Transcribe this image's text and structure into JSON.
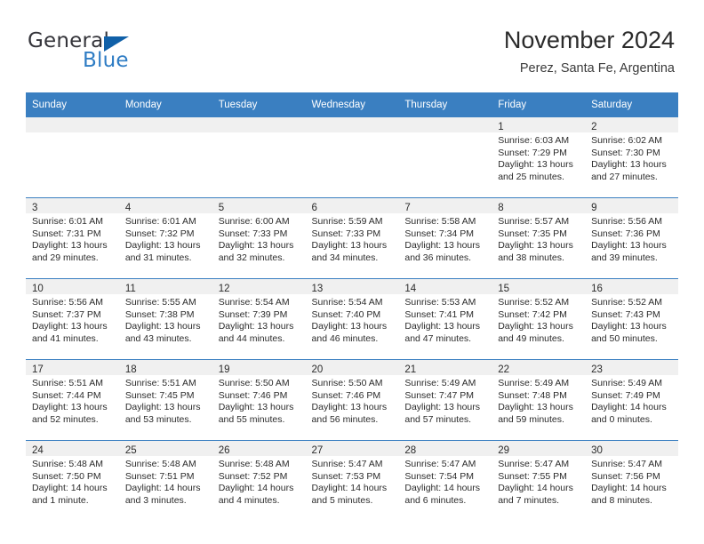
{
  "brand": {
    "name_part1": "General",
    "name_part2": "Blue",
    "triangle_color": "#1060a8",
    "blue_color": "#2e7cc4"
  },
  "header": {
    "title": "November 2024",
    "subtitle": "Perez, Santa Fe, Argentina",
    "header_bg": "#3a7fc1",
    "daynum_band_bg": "#f0f0f0"
  },
  "weekdays": [
    "Sunday",
    "Monday",
    "Tuesday",
    "Wednesday",
    "Thursday",
    "Friday",
    "Saturday"
  ],
  "weeks": [
    [
      {
        "day": "",
        "sunrise": "",
        "sunset": "",
        "daylight1": "",
        "daylight2": ""
      },
      {
        "day": "",
        "sunrise": "",
        "sunset": "",
        "daylight1": "",
        "daylight2": ""
      },
      {
        "day": "",
        "sunrise": "",
        "sunset": "",
        "daylight1": "",
        "daylight2": ""
      },
      {
        "day": "",
        "sunrise": "",
        "sunset": "",
        "daylight1": "",
        "daylight2": ""
      },
      {
        "day": "",
        "sunrise": "",
        "sunset": "",
        "daylight1": "",
        "daylight2": ""
      },
      {
        "day": "1",
        "sunrise": "Sunrise: 6:03 AM",
        "sunset": "Sunset: 7:29 PM",
        "daylight1": "Daylight: 13 hours",
        "daylight2": "and 25 minutes."
      },
      {
        "day": "2",
        "sunrise": "Sunrise: 6:02 AM",
        "sunset": "Sunset: 7:30 PM",
        "daylight1": "Daylight: 13 hours",
        "daylight2": "and 27 minutes."
      }
    ],
    [
      {
        "day": "3",
        "sunrise": "Sunrise: 6:01 AM",
        "sunset": "Sunset: 7:31 PM",
        "daylight1": "Daylight: 13 hours",
        "daylight2": "and 29 minutes."
      },
      {
        "day": "4",
        "sunrise": "Sunrise: 6:01 AM",
        "sunset": "Sunset: 7:32 PM",
        "daylight1": "Daylight: 13 hours",
        "daylight2": "and 31 minutes."
      },
      {
        "day": "5",
        "sunrise": "Sunrise: 6:00 AM",
        "sunset": "Sunset: 7:33 PM",
        "daylight1": "Daylight: 13 hours",
        "daylight2": "and 32 minutes."
      },
      {
        "day": "6",
        "sunrise": "Sunrise: 5:59 AM",
        "sunset": "Sunset: 7:33 PM",
        "daylight1": "Daylight: 13 hours",
        "daylight2": "and 34 minutes."
      },
      {
        "day": "7",
        "sunrise": "Sunrise: 5:58 AM",
        "sunset": "Sunset: 7:34 PM",
        "daylight1": "Daylight: 13 hours",
        "daylight2": "and 36 minutes."
      },
      {
        "day": "8",
        "sunrise": "Sunrise: 5:57 AM",
        "sunset": "Sunset: 7:35 PM",
        "daylight1": "Daylight: 13 hours",
        "daylight2": "and 38 minutes."
      },
      {
        "day": "9",
        "sunrise": "Sunrise: 5:56 AM",
        "sunset": "Sunset: 7:36 PM",
        "daylight1": "Daylight: 13 hours",
        "daylight2": "and 39 minutes."
      }
    ],
    [
      {
        "day": "10",
        "sunrise": "Sunrise: 5:56 AM",
        "sunset": "Sunset: 7:37 PM",
        "daylight1": "Daylight: 13 hours",
        "daylight2": "and 41 minutes."
      },
      {
        "day": "11",
        "sunrise": "Sunrise: 5:55 AM",
        "sunset": "Sunset: 7:38 PM",
        "daylight1": "Daylight: 13 hours",
        "daylight2": "and 43 minutes."
      },
      {
        "day": "12",
        "sunrise": "Sunrise: 5:54 AM",
        "sunset": "Sunset: 7:39 PM",
        "daylight1": "Daylight: 13 hours",
        "daylight2": "and 44 minutes."
      },
      {
        "day": "13",
        "sunrise": "Sunrise: 5:54 AM",
        "sunset": "Sunset: 7:40 PM",
        "daylight1": "Daylight: 13 hours",
        "daylight2": "and 46 minutes."
      },
      {
        "day": "14",
        "sunrise": "Sunrise: 5:53 AM",
        "sunset": "Sunset: 7:41 PM",
        "daylight1": "Daylight: 13 hours",
        "daylight2": "and 47 minutes."
      },
      {
        "day": "15",
        "sunrise": "Sunrise: 5:52 AM",
        "sunset": "Sunset: 7:42 PM",
        "daylight1": "Daylight: 13 hours",
        "daylight2": "and 49 minutes."
      },
      {
        "day": "16",
        "sunrise": "Sunrise: 5:52 AM",
        "sunset": "Sunset: 7:43 PM",
        "daylight1": "Daylight: 13 hours",
        "daylight2": "and 50 minutes."
      }
    ],
    [
      {
        "day": "17",
        "sunrise": "Sunrise: 5:51 AM",
        "sunset": "Sunset: 7:44 PM",
        "daylight1": "Daylight: 13 hours",
        "daylight2": "and 52 minutes."
      },
      {
        "day": "18",
        "sunrise": "Sunrise: 5:51 AM",
        "sunset": "Sunset: 7:45 PM",
        "daylight1": "Daylight: 13 hours",
        "daylight2": "and 53 minutes."
      },
      {
        "day": "19",
        "sunrise": "Sunrise: 5:50 AM",
        "sunset": "Sunset: 7:46 PM",
        "daylight1": "Daylight: 13 hours",
        "daylight2": "and 55 minutes."
      },
      {
        "day": "20",
        "sunrise": "Sunrise: 5:50 AM",
        "sunset": "Sunset: 7:46 PM",
        "daylight1": "Daylight: 13 hours",
        "daylight2": "and 56 minutes."
      },
      {
        "day": "21",
        "sunrise": "Sunrise: 5:49 AM",
        "sunset": "Sunset: 7:47 PM",
        "daylight1": "Daylight: 13 hours",
        "daylight2": "and 57 minutes."
      },
      {
        "day": "22",
        "sunrise": "Sunrise: 5:49 AM",
        "sunset": "Sunset: 7:48 PM",
        "daylight1": "Daylight: 13 hours",
        "daylight2": "and 59 minutes."
      },
      {
        "day": "23",
        "sunrise": "Sunrise: 5:49 AM",
        "sunset": "Sunset: 7:49 PM",
        "daylight1": "Daylight: 14 hours",
        "daylight2": "and 0 minutes."
      }
    ],
    [
      {
        "day": "24",
        "sunrise": "Sunrise: 5:48 AM",
        "sunset": "Sunset: 7:50 PM",
        "daylight1": "Daylight: 14 hours",
        "daylight2": "and 1 minute."
      },
      {
        "day": "25",
        "sunrise": "Sunrise: 5:48 AM",
        "sunset": "Sunset: 7:51 PM",
        "daylight1": "Daylight: 14 hours",
        "daylight2": "and 3 minutes."
      },
      {
        "day": "26",
        "sunrise": "Sunrise: 5:48 AM",
        "sunset": "Sunset: 7:52 PM",
        "daylight1": "Daylight: 14 hours",
        "daylight2": "and 4 minutes."
      },
      {
        "day": "27",
        "sunrise": "Sunrise: 5:47 AM",
        "sunset": "Sunset: 7:53 PM",
        "daylight1": "Daylight: 14 hours",
        "daylight2": "and 5 minutes."
      },
      {
        "day": "28",
        "sunrise": "Sunrise: 5:47 AM",
        "sunset": "Sunset: 7:54 PM",
        "daylight1": "Daylight: 14 hours",
        "daylight2": "and 6 minutes."
      },
      {
        "day": "29",
        "sunrise": "Sunrise: 5:47 AM",
        "sunset": "Sunset: 7:55 PM",
        "daylight1": "Daylight: 14 hours",
        "daylight2": "and 7 minutes."
      },
      {
        "day": "30",
        "sunrise": "Sunrise: 5:47 AM",
        "sunset": "Sunset: 7:56 PM",
        "daylight1": "Daylight: 14 hours",
        "daylight2": "and 8 minutes."
      }
    ]
  ]
}
